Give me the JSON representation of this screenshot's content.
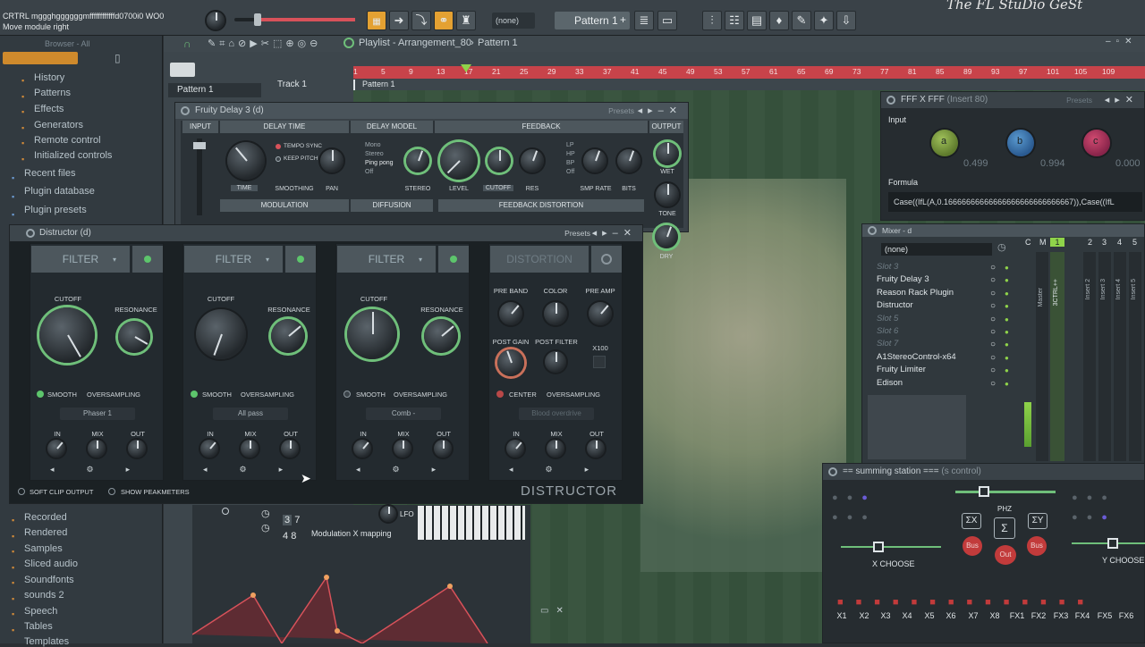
{
  "status": {
    "hint_title": "CRTRL mggghggggggmffffffffffffd0700i0 WO0",
    "hint_text": "Move module right"
  },
  "toolbar": {
    "pattern_mode": "(none)",
    "pattern": "Pattern 1",
    "watermark": "The FL StuDio GeSt"
  },
  "browser": {
    "title": "Browser - All",
    "items": [
      "History",
      "Patterns",
      "Effects",
      "Generators",
      "Remote control",
      "Initialized controls",
      "Recent files",
      "Plugin database",
      "Plugin presets"
    ],
    "items_bottom": [
      "Recorded",
      "Rendered",
      "Samples",
      "Sliced audio",
      "Soundfonts",
      "sounds 2",
      "Speech",
      "Tables",
      "Templates"
    ]
  },
  "playlist": {
    "title": "Playlist - Arrangement_80",
    "pattern": "Pattern 1",
    "track": "Track 1",
    "clip": "Pattern 1",
    "ruler": [
      "1",
      "5",
      "9",
      "13",
      "17",
      "21",
      "25",
      "29",
      "33",
      "37",
      "41",
      "45",
      "49",
      "53",
      "57",
      "61",
      "65",
      "69",
      "73",
      "77",
      "81",
      "85",
      "89",
      "93",
      "97",
      "101",
      "105",
      "109"
    ]
  },
  "fruity_delay": {
    "title": "Fruity Delay 3",
    "tag": "(d)",
    "presets": "Presets",
    "sections": {
      "input": "INPUT",
      "delay_time": "DELAY TIME",
      "delay_model": "DELAY MODEL",
      "feedback": "FEEDBACK",
      "output": "OUTPUT",
      "modulation": "MODULATION",
      "diffusion": "DIFFUSION",
      "feedback_distortion": "FEEDBACK DISTORTION"
    },
    "tempo_sync": "TEMPO SYNC",
    "keep_pitch": "KEEP PITCH",
    "time": "TIME",
    "smoothing": "SMOOTHING",
    "pan": "PAN",
    "models": [
      "Mono",
      "Stereo",
      "Ping pong",
      "Off"
    ],
    "stereo": "STEREO",
    "level": "LEVEL",
    "cutoff": "CUTOFF",
    "res": "RES",
    "filters": [
      "LP",
      "HP",
      "BP",
      "Off"
    ],
    "smp_rate": "SMP RATE",
    "bits": "BITS",
    "wet": "WET",
    "tone": "TONE",
    "dry": "DRY"
  },
  "distructor": {
    "title": "Distructor",
    "tag": "(d)",
    "presets": "Presets",
    "brand": "DISTRUCTOR",
    "soft_clip": "SOFT CLIP OUTPUT",
    "show_peak": "SHOW PEAKMETERS",
    "modules": [
      {
        "type": "FILTER",
        "k1": "CUTOFF",
        "k2": "RESONANCE",
        "toggle": "SMOOTH",
        "os": "OVERSAMPLING",
        "mode": "Phaser 1"
      },
      {
        "type": "FILTER",
        "k1": "CUTOFF",
        "k2": "RESONANCE",
        "toggle": "SMOOTH",
        "os": "OVERSAMPLING",
        "mode": "All pass"
      },
      {
        "type": "FILTER",
        "k1": "CUTOFF",
        "k2": "RESONANCE",
        "toggle": "SMOOTH",
        "os": "OVERSAMPLING",
        "mode": "Comb -"
      },
      {
        "type": "DISTORTION",
        "k1": "PRE BAND",
        "k2": "COLOR",
        "k3": "PRE AMP",
        "k4": "POST GAIN",
        "k5": "POST FILTER",
        "k6": "X100",
        "toggle": "CENTER",
        "os": "OVERSAMPLING",
        "mode": "Blood overdrive"
      }
    ],
    "io": [
      "IN",
      "MIX",
      "OUT"
    ]
  },
  "fff": {
    "title": "FFF X FFF",
    "tag": "(Insert 80)",
    "presets": "Presets",
    "input": "Input",
    "knobs": [
      {
        "name": "a",
        "value": "0.499",
        "color": "#8fb04a"
      },
      {
        "name": "b",
        "value": "0.994",
        "color": "#3f7fc0"
      },
      {
        "name": "c",
        "value": "0.000",
        "color": "#b8365a"
      }
    ],
    "formula_label": "Formula",
    "formula": "Case((IfL(A,0.16666666666666666666666666667)),Case((IfL"
  },
  "mixer": {
    "title": "Mixer - d",
    "preset": "(none)",
    "slots": [
      {
        "name": "Slot 3",
        "dim": true
      },
      {
        "name": "Fruity Delay 3",
        "dim": false
      },
      {
        "name": "Reason Rack Plugin",
        "dim": false
      },
      {
        "name": "Distructor",
        "dim": false
      },
      {
        "name": "Slot 5",
        "dim": true
      },
      {
        "name": "Slot 6",
        "dim": true
      },
      {
        "name": "Slot 7",
        "dim": true
      },
      {
        "name": "A1StereoControl-x64",
        "dim": false
      },
      {
        "name": "Fruity Limiter",
        "dim": false
      },
      {
        "name": "Edison",
        "dim": false
      }
    ],
    "channels": [
      "C",
      "M",
      "1",
      "2",
      "3",
      "4",
      "5"
    ],
    "strips": [
      "Master",
      "3CTRL++",
      "Insert 2",
      "Insert 3",
      "Insert 4",
      "Insert 5"
    ]
  },
  "summing": {
    "title": "== summing station ===",
    "tag": "(s control)",
    "phz": "PHZ",
    "sum_x": "ΣX",
    "sum": "Σ",
    "sum_y": "ΣY",
    "bus": "Bus",
    "out": "Out",
    "x_choose": "X CHOOSE",
    "y_choose": "Y CHOOSE",
    "buttons": [
      "X1",
      "X2",
      "X3",
      "X4",
      "X5",
      "X6",
      "X7",
      "X8",
      "FX1",
      "FX2",
      "FX3",
      "FX4",
      "FX5",
      "FX6"
    ]
  },
  "mod": {
    "lfo": "LFO",
    "mapping": "Modulation X mapping",
    "nums": [
      "3",
      "7",
      "4",
      "8"
    ]
  },
  "colors": {
    "green": "#6fbf7a",
    "accent_red": "#d8525a",
    "ruler_red": "#c8434a"
  }
}
